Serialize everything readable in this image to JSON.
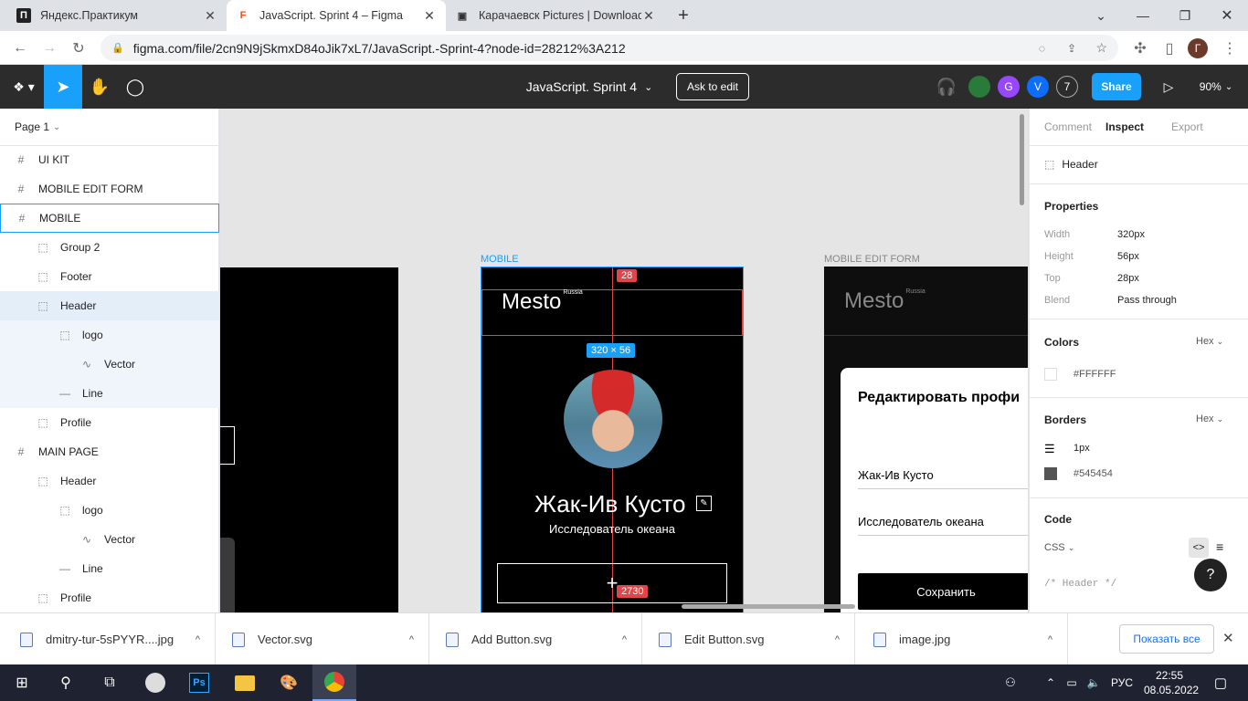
{
  "browser": {
    "tabs": [
      {
        "title": "Яндекс.Практикум",
        "fav": "П"
      },
      {
        "title": "JavaScript. Sprint 4 – Figma",
        "fav": "F"
      },
      {
        "title": "Карачаевск Pictures | Download",
        "fav": "▣"
      }
    ],
    "new_tab": "+",
    "url": "figma.com/file/2cn9N9jSkmxD84oJik7xL7/JavaScript.-Sprint-4?node-id=28212%3A212"
  },
  "figma": {
    "file_title": "JavaScript. Sprint 4",
    "ask_to_edit": "Ask to edit",
    "share": "Share",
    "zoom": "90%",
    "avatars": [
      {
        "letter": "G",
        "color": "#9747ff"
      },
      {
        "letter": "V",
        "color": "#0d6efd"
      },
      {
        "letter": "7",
        "color": "#2c2c2c"
      }
    ],
    "page_name": "Page 1",
    "layers": [
      {
        "name": "UI KIT",
        "icon": "#"
      },
      {
        "name": "MOBILE EDIT FORM",
        "icon": "#"
      },
      {
        "name": "MOBILE",
        "icon": "#"
      },
      {
        "name": "Group 2",
        "icon": "⬚"
      },
      {
        "name": "Footer",
        "icon": "⬚"
      },
      {
        "name": "Header",
        "icon": "⬚"
      },
      {
        "name": "logo",
        "icon": "⬚"
      },
      {
        "name": "Vector",
        "icon": "∿"
      },
      {
        "name": "Line",
        "icon": "—"
      },
      {
        "name": "Profile",
        "icon": "⬚"
      },
      {
        "name": "MAIN PAGE",
        "icon": "#"
      },
      {
        "name": "Header",
        "icon": "⬚"
      },
      {
        "name": "logo",
        "icon": "⬚"
      },
      {
        "name": "Vector",
        "icon": "∿"
      },
      {
        "name": "Line",
        "icon": "—"
      },
      {
        "name": "Profile",
        "icon": "⬚"
      }
    ],
    "inspect": {
      "tabs": [
        "Comment",
        "Inspect",
        "Export"
      ],
      "selected_layer": "Header",
      "properties_title": "Properties",
      "properties": [
        {
          "label": "Width",
          "value": "320px"
        },
        {
          "label": "Height",
          "value": "56px"
        },
        {
          "label": "Top",
          "value": "28px"
        },
        {
          "label": "Blend",
          "value": "Pass through"
        }
      ],
      "colors_title": "Colors",
      "colors_format": "Hex",
      "color_value": "#FFFFFF",
      "borders_title": "Borders",
      "borders_format": "Hex",
      "border_width": "1px",
      "border_color": "#545454",
      "code_title": "Code",
      "code_lang": "CSS",
      "code_comment": "/* Header */",
      "help": "?"
    },
    "canvas": {
      "frame_mobile_label": "MOBILE",
      "frame_edit_label": "MOBILE EDIT FORM",
      "logo_text": "Mesto",
      "logo_sup": "Russia",
      "measure_top": "28",
      "size_badge": "320 × 56",
      "profile_name": "Жак-Ив Кусто",
      "profile_job": "Исследователь океана",
      "bottom_badge": "2730",
      "edit_form_title": "Редактировать профи",
      "edit_name": "Жак-Ив Кусто",
      "edit_job": "Исследователь океана",
      "save_button": "Сохранить"
    }
  },
  "downloads": {
    "items": [
      "dmitry-tur-5sPYYR....jpg",
      "Vector.svg",
      "Add Button.svg",
      "Edit Button.svg",
      "image.jpg"
    ],
    "show_all": "Показать все"
  },
  "taskbar": {
    "lang": "РУС",
    "time": "22:55",
    "date": "08.05.2022"
  }
}
